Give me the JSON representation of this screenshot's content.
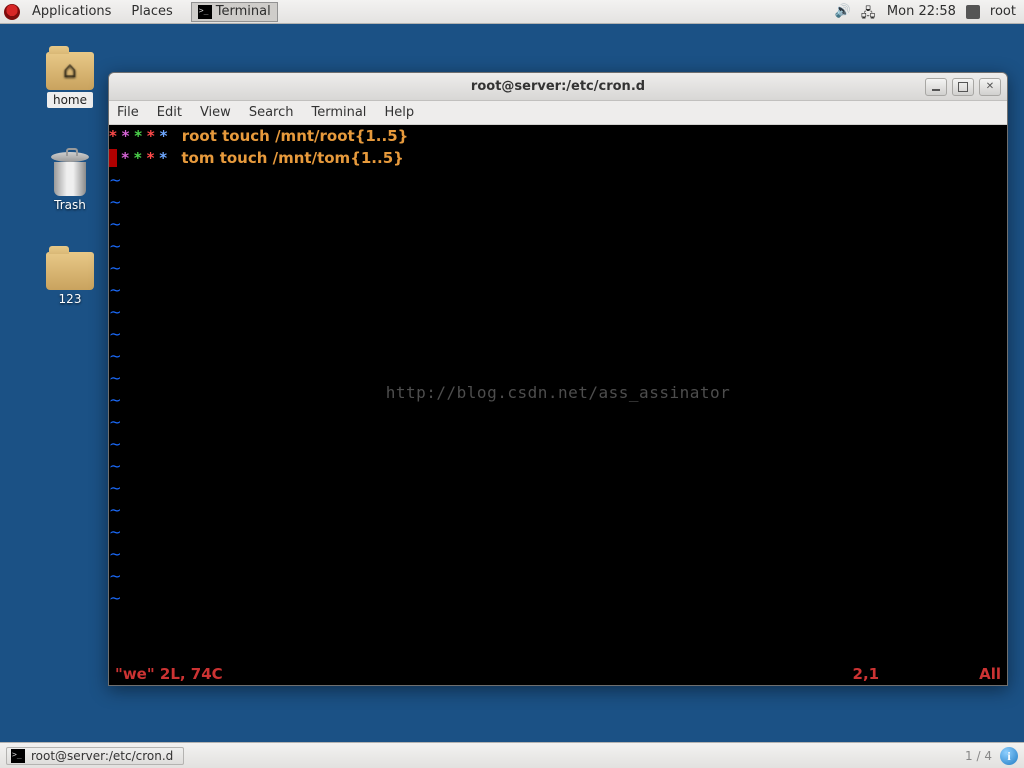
{
  "top_panel": {
    "menus": [
      "Applications",
      "Places"
    ],
    "task_label": "Terminal",
    "clock": "Mon 22:58",
    "user": "root"
  },
  "desktop": {
    "home_label": "home",
    "trash_label": "Trash",
    "folder1_label": "123"
  },
  "window": {
    "title": "root@server:/etc/cron.d",
    "menubar": [
      "File",
      "Edit",
      "View",
      "Search",
      "Terminal",
      "Help"
    ]
  },
  "terminal": {
    "lines": [
      {
        "stars": [
          "*",
          "*",
          "*",
          "*",
          "*"
        ],
        "user": "root",
        "cmd": "touch /mnt/root{1..5}",
        "cursor_row": false
      },
      {
        "stars": [
          "*",
          "*",
          "*",
          "*",
          "*"
        ],
        "user": "tom",
        "cmd": "touch /mnt/tom{1..5}",
        "cursor_row": true
      }
    ],
    "tilde_rows": 20,
    "status_left": "\"we\" 2L, 74C",
    "status_mid": "2,1",
    "status_right": "All",
    "watermark": "http://blog.csdn.net/ass_assinator"
  },
  "bottom_panel": {
    "task_label": "root@server:/etc/cron.d",
    "pager": "1 / 4"
  }
}
